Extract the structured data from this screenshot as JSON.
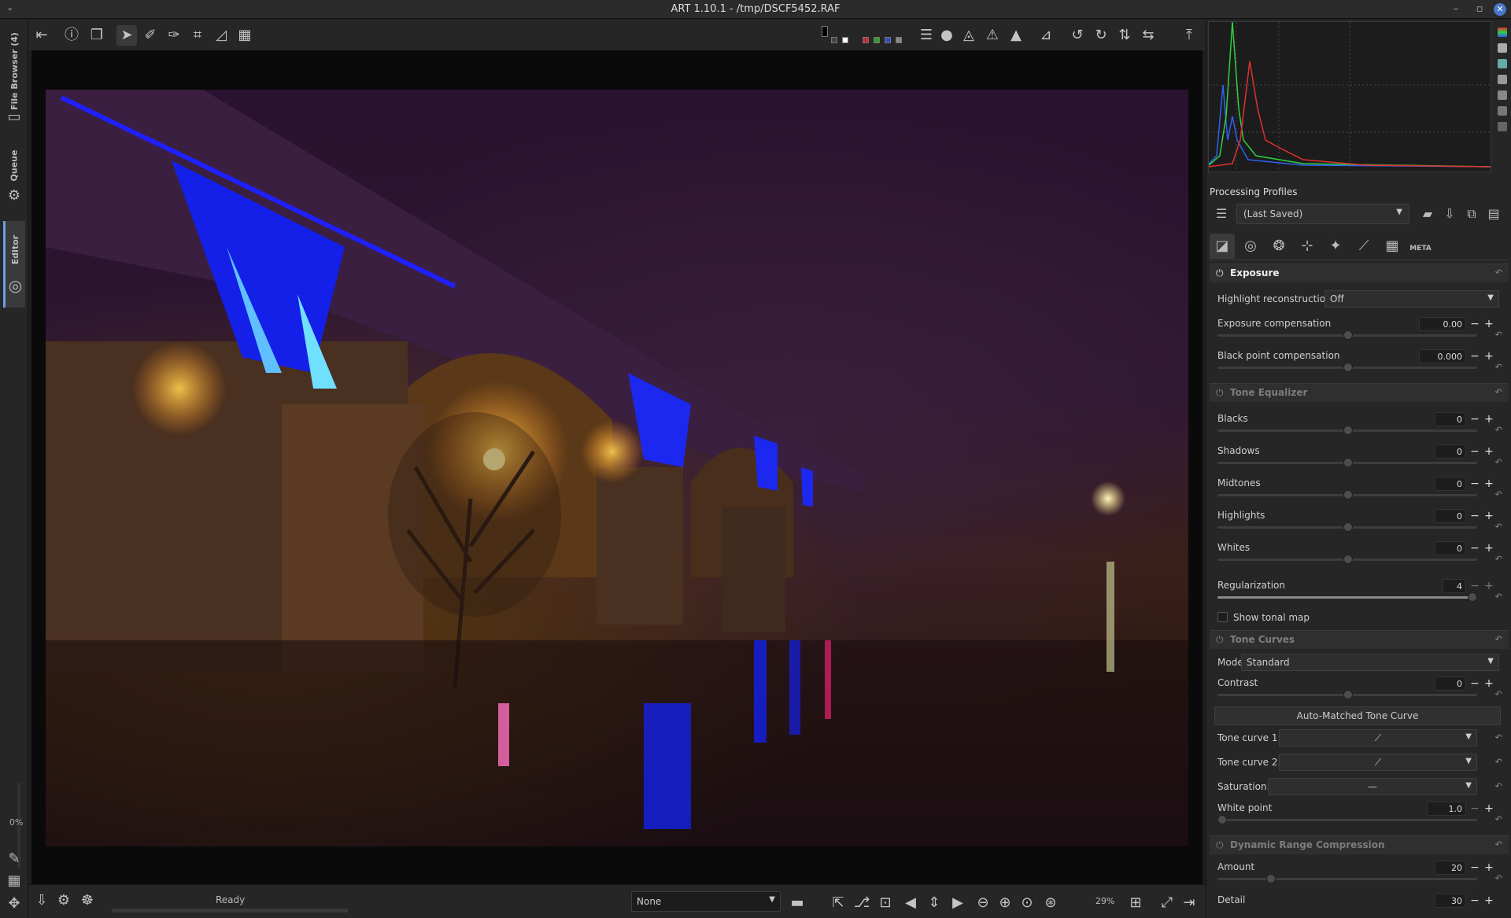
{
  "window": {
    "title": "ART 1.10.1 - /tmp/DSCF5452.RAF",
    "menu_glyph": "⌄",
    "min": "–",
    "max": "▫",
    "close": "✕"
  },
  "left_tabs": {
    "file_browser": "File Browser (4)",
    "queue": "Queue",
    "editor": "Editor",
    "zoom_pct": "0%"
  },
  "statusbar": {
    "status": "Ready",
    "preset": "None",
    "zoom": "29%"
  },
  "histogram": {
    "colors": {
      "red": "#e03030",
      "green": "#30d040",
      "blue": "#3060f0"
    }
  },
  "processing_profiles": {
    "label": "Processing Profiles",
    "selected": "(Last Saved)"
  },
  "tabs": {
    "meta": "META"
  },
  "exposure": {
    "title": "Exposure",
    "highlight_reconstruction_label": "Highlight reconstruction:",
    "highlight_reconstruction_value": "Off",
    "exposure_comp_label": "Exposure compensation",
    "exposure_comp_value": "0.00",
    "black_point_label": "Black point compensation",
    "black_point_value": "0.000"
  },
  "tone_equalizer": {
    "title": "Tone Equalizer",
    "blacks_label": "Blacks",
    "blacks_value": "0",
    "shadows_label": "Shadows",
    "shadows_value": "0",
    "midtones_label": "Midtones",
    "midtones_value": "0",
    "highlights_label": "Highlights",
    "highlights_value": "0",
    "whites_label": "Whites",
    "whites_value": "0",
    "regularization_label": "Regularization",
    "regularization_value": "4",
    "show_tonal_map": "Show tonal map"
  },
  "tone_curves": {
    "title": "Tone Curves",
    "mode_label": "Mode:",
    "mode_value": "Standard",
    "contrast_label": "Contrast",
    "contrast_value": "0",
    "auto_matched": "Auto-Matched Tone Curve",
    "curve1_label": "Tone curve 1:",
    "curve2_label": "Tone curve 2:",
    "saturation_label": "Saturation:",
    "white_point_label": "White point",
    "white_point_value": "1.0"
  },
  "drc": {
    "title": "Dynamic Range Compression",
    "amount_label": "Amount",
    "amount_value": "20",
    "detail_label": "Detail",
    "detail_value": "30"
  }
}
